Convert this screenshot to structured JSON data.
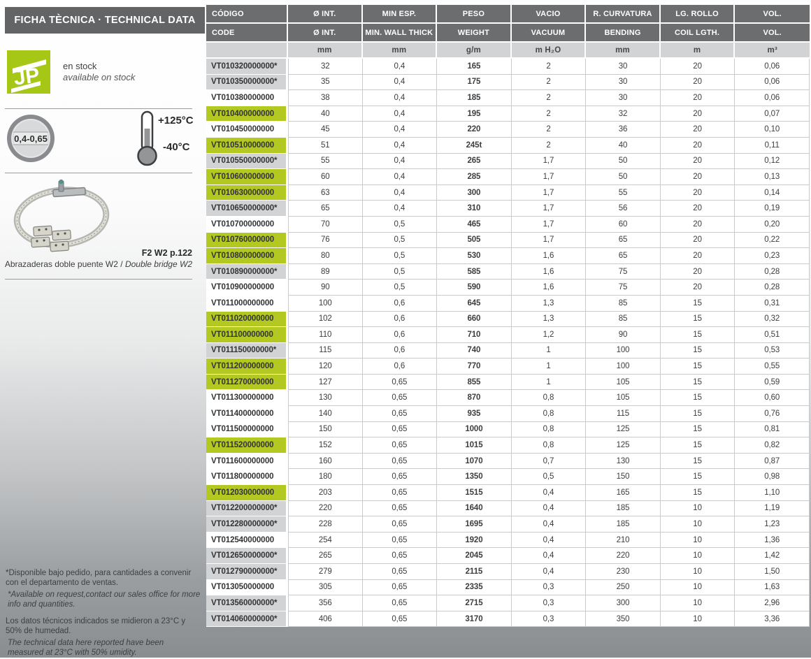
{
  "title": "FICHA TÈCNICA · TECHNICAL DATA",
  "colors": {
    "brand_green": "#a6c716",
    "row_highlight_green": "#b3c922",
    "row_highlight_gray": "#d2d3d5",
    "header_gray": "#6b6d6f",
    "page_fade_gray": "#8a8d90"
  },
  "sidebar": {
    "stock": {
      "logo_text": "JP",
      "line_es": "en stock",
      "line_en": "available on stock"
    },
    "ratio_badge": "0,4-0,65",
    "temperature": {
      "max": "+125°C",
      "min": "-40°C"
    },
    "product_ref": "F2 W2 p.122",
    "product_caption_es": "Abrazaderas doble puente W2 / ",
    "product_caption_en": "Double bridge W2",
    "notes": [
      {
        "text": "*Disponible bajo pedido, para cantidades a convenir con el departamento de ventas.",
        "style": "normal",
        "gap": false
      },
      {
        "text": "*Available on request,contact our sales office for more info and quantities.",
        "style": "italic",
        "gap": true
      },
      {
        "text": "Los datos técnicos indicados se midieron a 23°C y 50% de humedad.",
        "style": "normal",
        "gap": false
      },
      {
        "text": "The technical data here reported have been measured at 23°C with 50% umidity.",
        "style": "italic",
        "gap": false
      }
    ]
  },
  "table": {
    "header_row1": [
      "CÓDIGO",
      "Ø INT.",
      "MIN ESP.",
      "PESO",
      "VACIO",
      "R. CURVATURA",
      "LG. ROLLO",
      "VOL."
    ],
    "header_row2": [
      "CODE",
      "Ø INT.",
      "MIN. WALL THICK",
      "WEIGHT",
      "VACUUM",
      "BENDING",
      "COIL LGTH.",
      "VOL."
    ],
    "units": [
      "",
      "mm",
      "mm",
      "g/m",
      "m H₂O",
      "mm",
      "m",
      "m³"
    ],
    "rows": [
      {
        "code": "VT010320000000*",
        "highlight": "gray",
        "values": [
          "32",
          "0,4",
          "165",
          "2",
          "30",
          "20",
          "0,06"
        ]
      },
      {
        "code": "VT010350000000*",
        "highlight": "gray",
        "values": [
          "35",
          "0,4",
          "175",
          "2",
          "30",
          "20",
          "0,06"
        ]
      },
      {
        "code": "VT010380000000",
        "highlight": "white",
        "values": [
          "38",
          "0,4",
          "185",
          "2",
          "30",
          "20",
          "0,06"
        ]
      },
      {
        "code": "VT010400000000",
        "highlight": "green",
        "values": [
          "40",
          "0,4",
          "195",
          "2",
          "32",
          "20",
          "0,07"
        ]
      },
      {
        "code": "VT010450000000",
        "highlight": "white",
        "values": [
          "45",
          "0,4",
          "220",
          "2",
          "36",
          "20",
          "0,10"
        ]
      },
      {
        "code": "VT010510000000",
        "highlight": "green",
        "values": [
          "51",
          "0,4",
          "245t",
          "2",
          "40",
          "20",
          "0,11"
        ]
      },
      {
        "code": "VT010550000000*",
        "highlight": "gray",
        "values": [
          "55",
          "0,4",
          "265",
          "1,7",
          "50",
          "20",
          "0,12"
        ]
      },
      {
        "code": "VT010600000000",
        "highlight": "green",
        "values": [
          "60",
          "0,4",
          "285",
          "1,7",
          "50",
          "20",
          "0,13"
        ]
      },
      {
        "code": "VT010630000000",
        "highlight": "green",
        "values": [
          "63",
          "0,4",
          "300",
          "1,7",
          "55",
          "20",
          "0,14"
        ]
      },
      {
        "code": "VT010650000000*",
        "highlight": "gray",
        "values": [
          "65",
          "0,4",
          "310",
          "1,7",
          "56",
          "20",
          "0,19"
        ]
      },
      {
        "code": "VT010700000000",
        "highlight": "white",
        "values": [
          "70",
          "0,5",
          "465",
          "1,7",
          "60",
          "20",
          "0,20"
        ]
      },
      {
        "code": "VT010760000000",
        "highlight": "green",
        "values": [
          "76",
          "0,5",
          "505",
          "1,7",
          "65",
          "20",
          "0,22"
        ]
      },
      {
        "code": "VT010800000000",
        "highlight": "green",
        "values": [
          "80",
          "0,5",
          "530",
          "1,6",
          "65",
          "20",
          "0,23"
        ]
      },
      {
        "code": "VT010890000000*",
        "highlight": "gray",
        "values": [
          "89",
          "0,5",
          "585",
          "1,6",
          "75",
          "20",
          "0,28"
        ]
      },
      {
        "code": "VT010900000000",
        "highlight": "white",
        "values": [
          "90",
          "0,5",
          "590",
          "1,6",
          "75",
          "20",
          "0,28"
        ]
      },
      {
        "code": "VT011000000000",
        "highlight": "white",
        "values": [
          "100",
          "0,6",
          "645",
          "1,3",
          "85",
          "15",
          "0,31"
        ]
      },
      {
        "code": "VT011020000000",
        "highlight": "green",
        "values": [
          "102",
          "0,6",
          "660",
          "1,3",
          "85",
          "15",
          "0,32"
        ]
      },
      {
        "code": "VT011100000000",
        "highlight": "green",
        "values": [
          "110",
          "0,6",
          "710",
          "1,2",
          "90",
          "15",
          "0,51"
        ]
      },
      {
        "code": "VT011150000000*",
        "highlight": "gray",
        "values": [
          "115",
          "0,6",
          "740",
          "1",
          "100",
          "15",
          "0,53"
        ]
      },
      {
        "code": "VT011200000000",
        "highlight": "green",
        "values": [
          "120",
          "0,6",
          "770",
          "1",
          "100",
          "15",
          "0,55"
        ]
      },
      {
        "code": "VT011270000000",
        "highlight": "green",
        "values": [
          "127",
          "0,65",
          "855",
          "1",
          "105",
          "15",
          "0,59"
        ]
      },
      {
        "code": "VT011300000000",
        "highlight": "white",
        "values": [
          "130",
          "0,65",
          "870",
          "0,8",
          "105",
          "15",
          "0,60"
        ]
      },
      {
        "code": "VT011400000000",
        "highlight": "white",
        "values": [
          "140",
          "0,65",
          "935",
          "0,8",
          "115",
          "15",
          "0,76"
        ]
      },
      {
        "code": "VT011500000000",
        "highlight": "white",
        "values": [
          "150",
          "0,65",
          "1000",
          "0,8",
          "125",
          "15",
          "0,81"
        ]
      },
      {
        "code": "VT011520000000",
        "highlight": "green",
        "values": [
          "152",
          "0,65",
          "1015",
          "0,8",
          "125",
          "15",
          "0,82"
        ]
      },
      {
        "code": "VT011600000000",
        "highlight": "white",
        "values": [
          "160",
          "0,65",
          "1070",
          "0,7",
          "130",
          "15",
          "0,87"
        ]
      },
      {
        "code": "VT011800000000",
        "highlight": "white",
        "values": [
          "180",
          "0,65",
          "1350",
          "0,5",
          "150",
          "15",
          "0,98"
        ]
      },
      {
        "code": "VT012030000000",
        "highlight": "green",
        "values": [
          "203",
          "0,65",
          "1515",
          "0,4",
          "165",
          "15",
          "1,10"
        ]
      },
      {
        "code": "VT012200000000*",
        "highlight": "gray",
        "values": [
          "220",
          "0,65",
          "1640",
          "0,4",
          "185",
          "10",
          "1,19"
        ]
      },
      {
        "code": "VT012280000000*",
        "highlight": "gray",
        "values": [
          "228",
          "0,65",
          "1695",
          "0,4",
          "185",
          "10",
          "1,23"
        ]
      },
      {
        "code": "VT012540000000",
        "highlight": "white",
        "values": [
          "254",
          "0,65",
          "1920",
          "0,4",
          "210",
          "10",
          "1,36"
        ]
      },
      {
        "code": "VT012650000000*",
        "highlight": "gray",
        "values": [
          "265",
          "0,65",
          "2045",
          "0,4",
          "220",
          "10",
          "1,42"
        ]
      },
      {
        "code": "VT012790000000*",
        "highlight": "gray",
        "values": [
          "279",
          "0,65",
          "2115",
          "0,4",
          "230",
          "10",
          "1,50"
        ]
      },
      {
        "code": "VT013050000000",
        "highlight": "white",
        "values": [
          "305",
          "0,65",
          "2335",
          "0,3",
          "250",
          "10",
          "1,63"
        ]
      },
      {
        "code": "VT013560000000*",
        "highlight": "gray",
        "values": [
          "356",
          "0,65",
          "2715",
          "0,3",
          "300",
          "10",
          "2,96"
        ]
      },
      {
        "code": "VT014060000000*",
        "highlight": "gray",
        "values": [
          "406",
          "0,65",
          "3170",
          "0,3",
          "350",
          "10",
          "3,36"
        ]
      }
    ]
  }
}
